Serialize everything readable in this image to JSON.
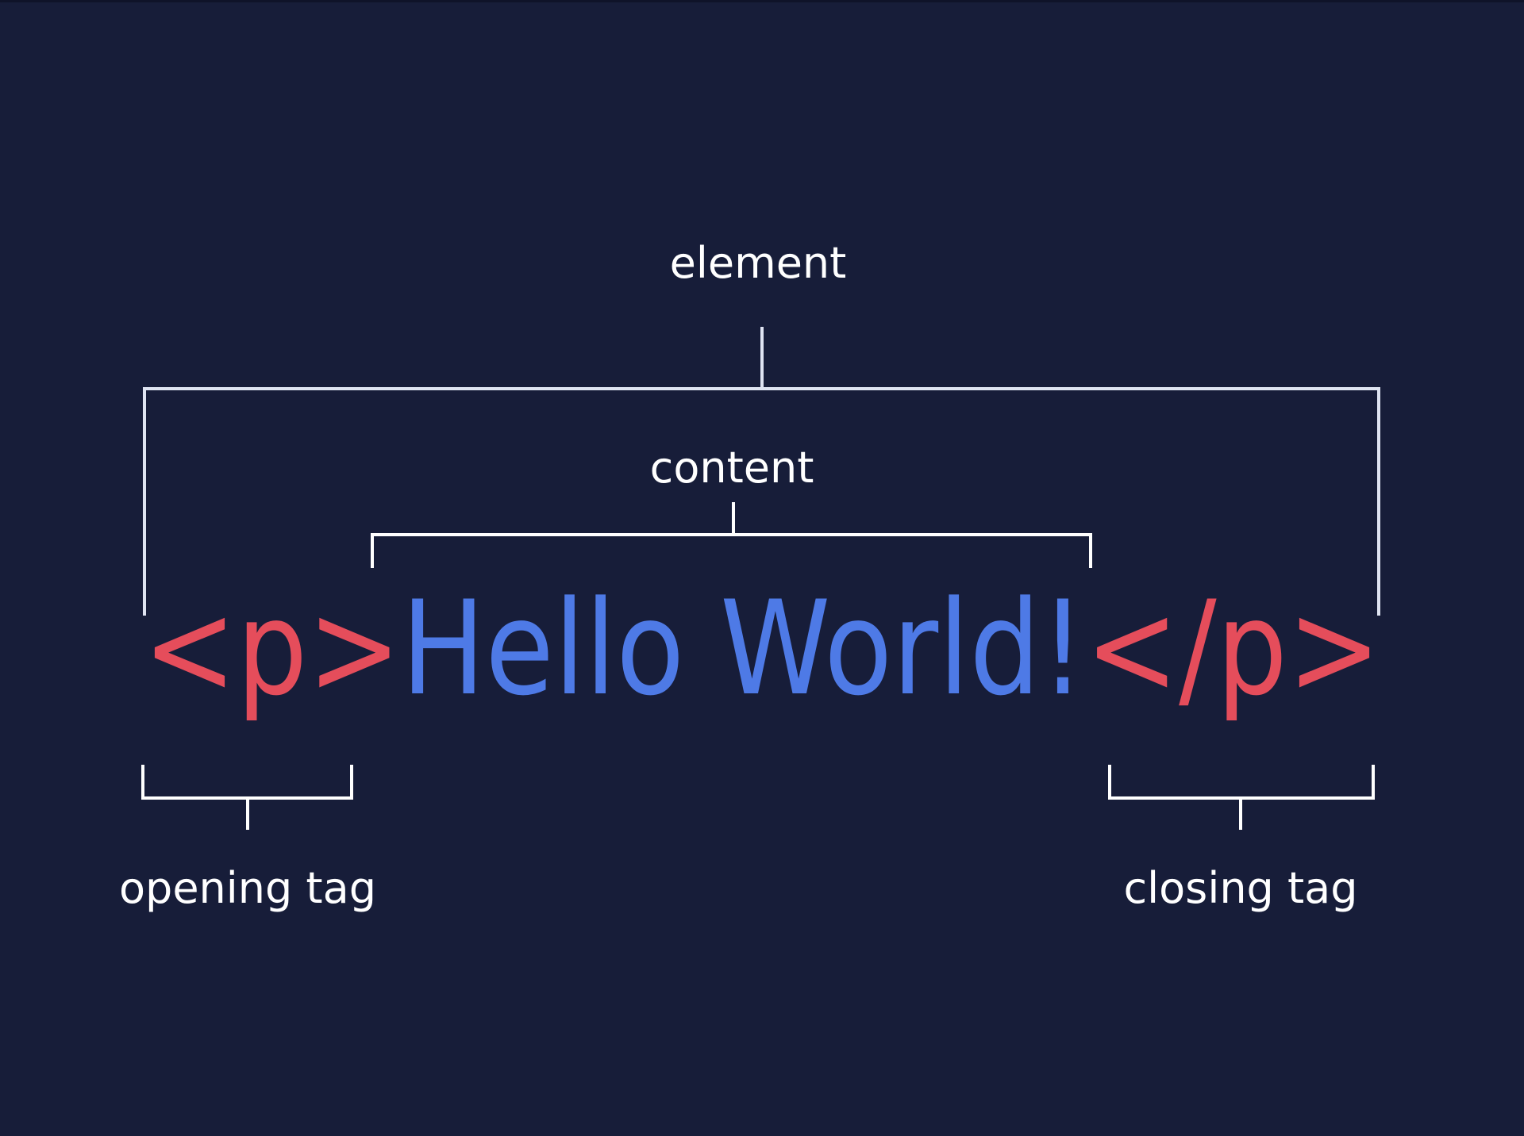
{
  "labels": {
    "element": "element",
    "content": "content",
    "opening_tag": "opening tag",
    "closing_tag": "closing tag"
  },
  "code": {
    "opening_tag": "<p>",
    "content": "Hello World!",
    "closing_tag": "</p>"
  },
  "colors": {
    "background": "#171d39",
    "tag": "#e54d5b",
    "content": "#4e7ae6",
    "label": "#ffffff",
    "element_bracket": "#dfe4f2",
    "bracket": "#ffffff"
  }
}
